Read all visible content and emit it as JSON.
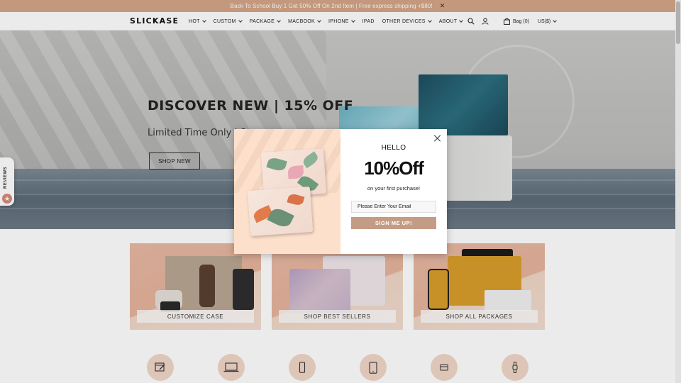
{
  "announcement": {
    "text": "Back To School Buy 1 Get 50% Off On 2nd Item | Free express shipping +$80!",
    "close": "✕"
  },
  "header": {
    "logo": "SLICKASE",
    "nav": [
      "HOT",
      "CUSTOM",
      "PACKAGE",
      "MACBOOK",
      "IPHONE",
      "IPAD",
      "OTHER DEVICES",
      "ABOUT"
    ],
    "nav_has_dropdown": [
      true,
      true,
      true,
      true,
      true,
      false,
      true,
      true
    ],
    "bag": "Bag (0)",
    "currency": "US($)"
  },
  "hero": {
    "title": "DISCOVER NEW | 15% OFF",
    "subtitle": "Limited Time Only | 8",
    "button": "SHOP NEW"
  },
  "reviews_tab": {
    "label": "REVIEWS",
    "icon": "star-icon"
  },
  "categories": [
    {
      "label": "CUSTOMIZE CASE"
    },
    {
      "label": "SHOP BEST SELLERS"
    },
    {
      "label": "SHOP ALL PACKAGES"
    }
  ],
  "bottom_icons": [
    "custom-design-icon",
    "laptop-icon",
    "phone-icon",
    "tablet-icon",
    "card-icon",
    "watch-icon"
  ],
  "popup": {
    "hello": "HELLO",
    "offer": "10%Off",
    "subtext": "on your first purchase!",
    "email_placeholder": "Please Enter Your Email",
    "button": "SIGN ME UP!"
  },
  "colors": {
    "announcement_bg": "#d4a587",
    "signup_button": "#c49c85",
    "category_bg": "#e8b9a3",
    "popup_image_bg": "#fde0cb"
  }
}
